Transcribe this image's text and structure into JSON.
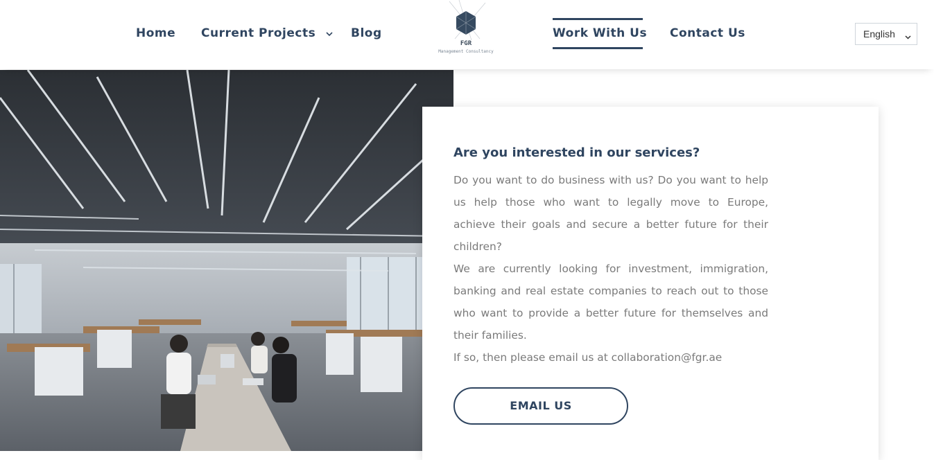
{
  "nav": {
    "items": [
      {
        "label": "Home"
      },
      {
        "label": "Current Projects"
      },
      {
        "label": "Blog"
      },
      {
        "label": "Work With Us"
      },
      {
        "label": "Contact Us"
      }
    ],
    "active": "Work With Us"
  },
  "logo": {
    "name": "FGR",
    "tagline": "Management Consultancy"
  },
  "language": {
    "selected": "English"
  },
  "hero": {
    "image": "office-interior-photo"
  },
  "card": {
    "title": "Are you interested in our services?",
    "paragraph1": "Do you want to do business with us? Do you want to help us help those who want to legally move to Europe, achieve their goals and secure a better future for their children?",
    "paragraph2": "We are currently looking for investment, immigration, banking and real estate companies to reach out to those who want to provide a better future for themselves and their families.",
    "paragraph3": "If so, then please email us at collaboration@fgr.ae",
    "button_label": "EMAIL US"
  },
  "colors": {
    "primary": "#2f4560",
    "body_text": "#7a7a7a"
  }
}
